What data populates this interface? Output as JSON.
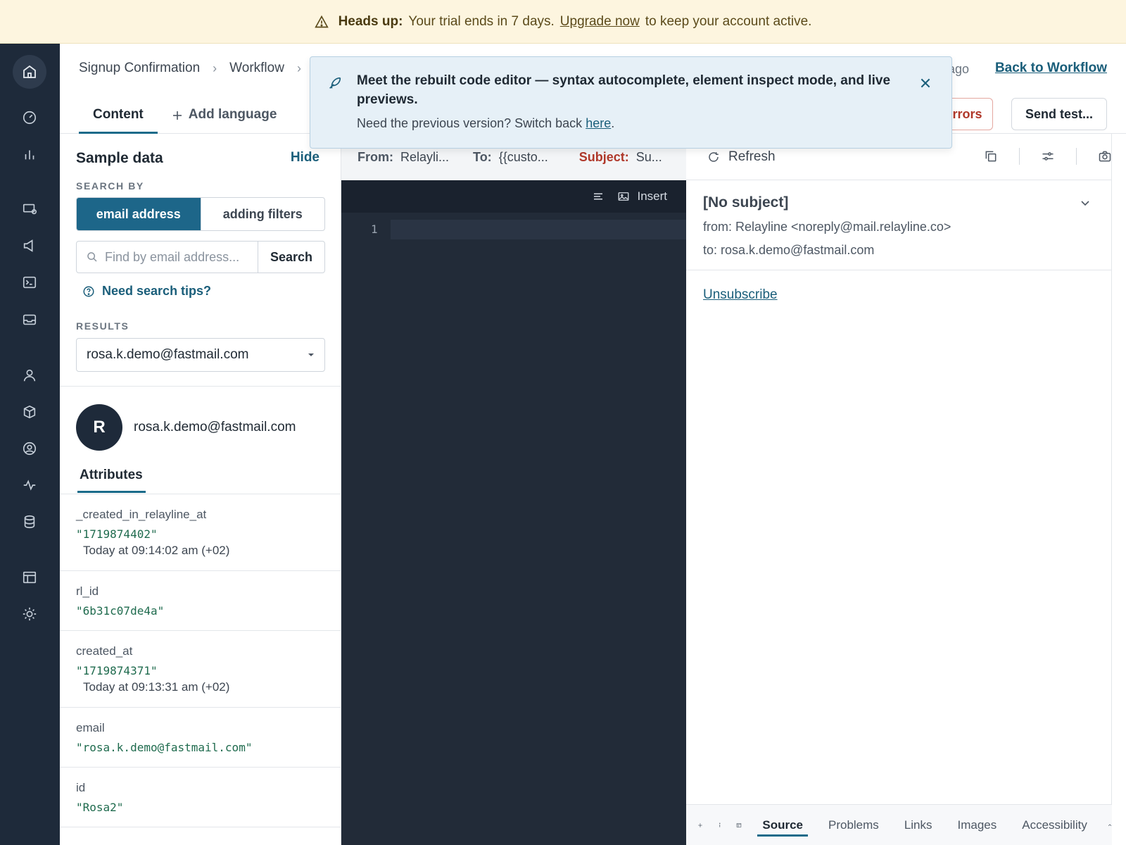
{
  "banner": {
    "prefix": "Heads up:",
    "text_before": "Your trial ends in 7 days.",
    "link": "Upgrade now",
    "text_after": "to keep your account active."
  },
  "header": {
    "breadcrumbs": [
      "Signup Confirmation",
      "Workflow"
    ],
    "breadcrumb_separator": "›",
    "saved_status": "ago",
    "back_link": "Back to Workflow",
    "tabs": {
      "content": "Content",
      "add_language": "Add language"
    },
    "errors_button": "errors",
    "send_test_button": "Send test..."
  },
  "toast": {
    "title": "Meet the rebuilt code editor — syntax autocomplete, element inspect mode, and live previews.",
    "body": "Need the previous version? Switch back",
    "link": "here",
    "after_link": "."
  },
  "sample_data": {
    "title": "Sample data",
    "hide": "Hide",
    "search_by_label": "SEARCH BY",
    "search_by_options": [
      "email address",
      "adding filters"
    ],
    "search_placeholder": "Find by email address...",
    "search_button": "Search",
    "tips": "Need search tips?",
    "results_label": "RESULTS",
    "results_value": "rosa.k.demo@fastmail.com",
    "avatar_initial": "R",
    "profile_email": "rosa.k.demo@fastmail.com",
    "attributes_tab": "Attributes",
    "attributes": [
      {
        "key": "_created_in_relayline_at",
        "value": "\"1719874402\"",
        "hint": "Today at 09:14:02 am (+02)"
      },
      {
        "key": "rl_id",
        "value": "\"6b31c07de4a\"",
        "hint": ""
      },
      {
        "key": "created_at",
        "value": "\"1719874371\"",
        "hint": "Today at 09:13:31 am (+02)"
      },
      {
        "key": "email",
        "value": "\"rosa.k.demo@fastmail.com\"",
        "hint": ""
      },
      {
        "key": "id",
        "value": "\"Rosa2\"",
        "hint": ""
      }
    ]
  },
  "editor": {
    "from_label": "From:",
    "from_value": "Relayli...",
    "to_label": "To:",
    "to_value": "{{custo...",
    "subject_label": "Subject:",
    "subject_value": "Su...",
    "insert": "Insert",
    "line_number": "1"
  },
  "preview": {
    "refresh": "Refresh",
    "subject": "[No subject]",
    "from": "from: Relayline <noreply@mail.relayline.co>",
    "to": "to: rosa.k.demo@fastmail.com",
    "unsubscribe": "Unsubscribe",
    "bottom_tabs": [
      "Source",
      "Problems",
      "Links",
      "Images",
      "Accessibility"
    ],
    "active_bottom_tab": "Source"
  },
  "colors": {
    "rail": "#1e2a3a",
    "accent": "#1d6689",
    "banner_bg": "#fdf5df",
    "error": "#b0382a",
    "editor_bg": "#222b38"
  }
}
